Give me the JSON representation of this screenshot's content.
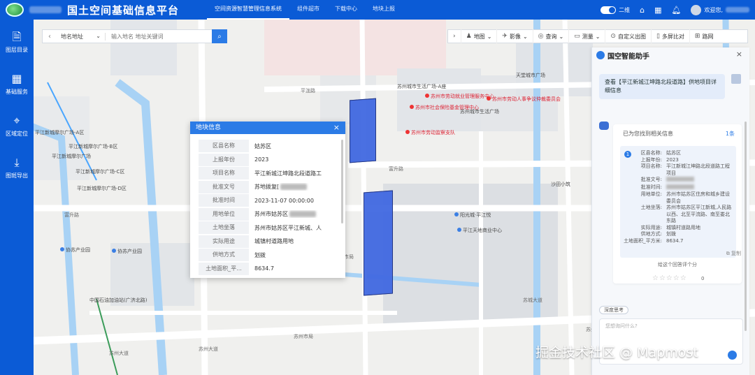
{
  "app": {
    "title": "国土空间基础信息平台"
  },
  "topnav": [
    "空间资源智慧管理信息系统",
    "组件超市",
    "下载中心",
    "地块上报"
  ],
  "header_right": {
    "toggle_label": "二维",
    "greeting": "欢迎您,"
  },
  "sidebar": [
    {
      "label": "图层目录",
      "icon": "layers-icon"
    },
    {
      "label": "基础服务",
      "icon": "grid-icon"
    },
    {
      "label": "区域定位",
      "icon": "location-pin-icon"
    },
    {
      "label": "图斑导出",
      "icon": "download-icon"
    }
  ],
  "search": {
    "type": "地名地址",
    "placeholder": "输入地名 地址关键词"
  },
  "toolbar": [
    "地图",
    "影像",
    "查询",
    "测量",
    "自定义出图",
    "多屏比对",
    "路网"
  ],
  "popup": {
    "title": "地块信息",
    "rows": [
      {
        "k": "区县名称",
        "v": "姑苏区"
      },
      {
        "k": "上报年份",
        "v": "2023"
      },
      {
        "k": "项目名称",
        "v": "平江新城江坤路北段道路工"
      },
      {
        "k": "批准文号",
        "v": "苏地拨复["
      },
      {
        "k": "批准时间",
        "v": "2023-11-07 00:00:00"
      },
      {
        "k": "用地单位",
        "v": "苏州市姑苏区"
      },
      {
        "k": "土地坐落",
        "v": "苏州市姑苏区平江新城、人"
      },
      {
        "k": "实际用途",
        "v": "城镇村道路用地"
      },
      {
        "k": "供地方式",
        "v": "划拨"
      },
      {
        "k": "土地面积_平...",
        "v": "8634.7"
      }
    ]
  },
  "assistant": {
    "title": "国空智能助手",
    "question": "查看【平江新城江坤路北段道路】供地项目详细信息",
    "found": "已为您找到相关信息",
    "count": "1条",
    "index": "1",
    "rows": [
      {
        "k": "区县名称:",
        "v": "姑苏区"
      },
      {
        "k": "上报年份:",
        "v": "2023"
      },
      {
        "k": "项目名称:",
        "v": "平江新城江坤路北段道路工程项目"
      },
      {
        "k": "批准文号:",
        "v": ""
      },
      {
        "k": "批准时间:",
        "v": ""
      },
      {
        "k": "用地单位:",
        "v": "苏州市姑苏区住房和城乡建设委员会"
      },
      {
        "k": "土地坐落:",
        "v": "苏州市姑苏区平江新城,人民路以西、北至平流路、南至娄北东路"
      },
      {
        "k": "实际用途:",
        "v": "城镇村道路用地"
      },
      {
        "k": "供地方式:",
        "v": "划拨"
      },
      {
        "k": "土地面积_平方米:",
        "v": "8634.7"
      }
    ],
    "copy": "复制",
    "rate": "给这个回答评个分",
    "stars": "☆☆☆☆☆",
    "star_value": "0",
    "deep_think": "深度思考",
    "input_placeholder": "您想询问什么?"
  },
  "map_labels": [
    {
      "t": "平江新城摩尔广场-A区"
    },
    {
      "t": "平江新城摩尔广场-B区"
    },
    {
      "t": "平江新城摩尔广场"
    },
    {
      "t": "平江新城摩尔广场-C区"
    },
    {
      "t": "平江新城摩尔广场-D区"
    },
    {
      "t": "平泷路"
    },
    {
      "t": "苏州城市生活广场-A座"
    },
    {
      "t": "苏州市劳动就业管理服务中心"
    },
    {
      "t": "苏州市社会保险基金管理中心"
    },
    {
      "t": "苏州城市生活广场"
    },
    {
      "t": "苏州市劳动人事争议仲裁委员会"
    },
    {
      "t": "苏州市劳动监察支队"
    },
    {
      "t": "天堂城市广场"
    },
    {
      "t": "富升路"
    },
    {
      "t": "沙田小筑"
    },
    {
      "t": "阳光城·平江悦"
    },
    {
      "t": "平江天地商业中心"
    },
    {
      "t": "苏城大道"
    },
    {
      "t": "苏州大道"
    },
    {
      "t": "协苏产业园"
    },
    {
      "t": "中国石油加油站(广济北路)"
    },
    {
      "t": "苏州市局"
    }
  ],
  "watermark": "掘金技术社区 @ Mapmost"
}
